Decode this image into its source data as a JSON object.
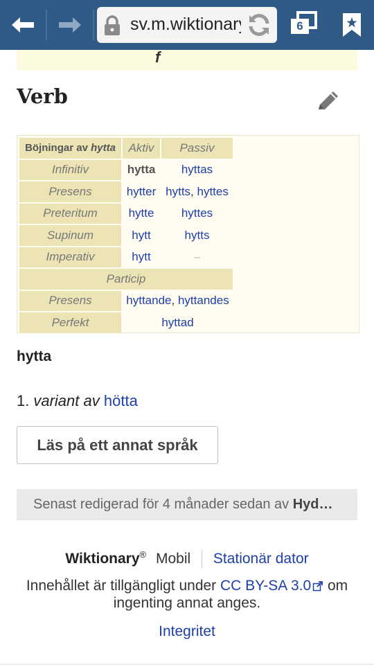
{
  "browser": {
    "url": "sv.m.wiktionary.org",
    "tabs_count": "6"
  },
  "page": {
    "top_remnant": "f",
    "heading": "Verb",
    "table": {
      "header": {
        "prefix": "Böjningar av ",
        "word": "hytta",
        "aktiv": "Aktiv",
        "passiv": "Passiv"
      },
      "rows": [
        {
          "label": "Infinitiv",
          "aktiv": "hytta",
          "passiv": "hyttas"
        },
        {
          "label": "Presens",
          "aktiv": "hytter",
          "passiv_a": "hytts",
          "sep": ", ",
          "passiv_b": "hyttes"
        },
        {
          "label": "Preteritum",
          "aktiv": "hytte",
          "passiv": "hyttes"
        },
        {
          "label": "Supinum",
          "aktiv": "hytt",
          "passiv": "hytts"
        },
        {
          "label": "Imperativ",
          "aktiv": "hytt",
          "passiv": "–"
        }
      ],
      "particip_label": "Particip",
      "particip_rows": [
        {
          "label": "Presens",
          "value_a": "hyttande",
          "sep": ", ",
          "value_b": "hyttandes"
        },
        {
          "label": "Perfekt",
          "value": "hyttad"
        }
      ]
    },
    "headword": "hytta",
    "definition": {
      "num": "1.",
      "text": "variant av",
      "link": "hötta"
    },
    "lang_button": "Läs på ett annat språk",
    "last_edited": {
      "text": "Senast redigerad för 4 månader sedan av ",
      "user": "Hyd…"
    },
    "footer": {
      "brand": "Wiktionary",
      "reg": "®",
      "mode": "Mobil",
      "desktop": "Stationär dator",
      "license_pre": "Innehållet är tillgängligt under ",
      "license_link": "CC BY-SA 3.0",
      "license_post": " om",
      "license_line2": "ingenting annat anges.",
      "privacy": "Integritet"
    }
  }
}
